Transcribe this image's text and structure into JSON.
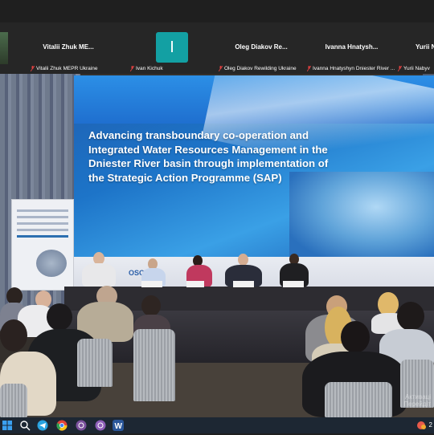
{
  "participants": [
    {
      "name": "Vitalii Zhuk ME...",
      "label": "Vitalii Zhuk MEPR Ukraine"
    },
    {
      "name": "",
      "label": "Ivan Kichuk",
      "avatar_letter": "I"
    },
    {
      "name": "Oleg Diakov Re...",
      "label": "Oleg Diakov Rewilding Ukraine"
    },
    {
      "name": "Ivanna Hnatysh...",
      "label": "Ivanna Hnatyshyn Dniester River ..."
    },
    {
      "name": "Yurii N",
      "label": "Yurii Nabyv"
    }
  ],
  "slide": {
    "title": "Advancing transboundary co-operation and Integrated Water Resources Management in the Dniester River basin through implementation of the Strategic Action Programme (SAP)",
    "logo_text": "OSC"
  },
  "watermark": {
    "line1": "Активаці",
    "line2": "Перейдіт"
  },
  "taskbar": {
    "icons": [
      "windows-icon",
      "search-icon",
      "telegram-icon",
      "chrome-icon",
      "viber-icon",
      "word-icon",
      "zoom-icon"
    ],
    "clock": "2"
  },
  "colors": {
    "avatar": "#13a0a3",
    "slide_blue": "#1d74c8",
    "mic_muted": "#e04040"
  }
}
